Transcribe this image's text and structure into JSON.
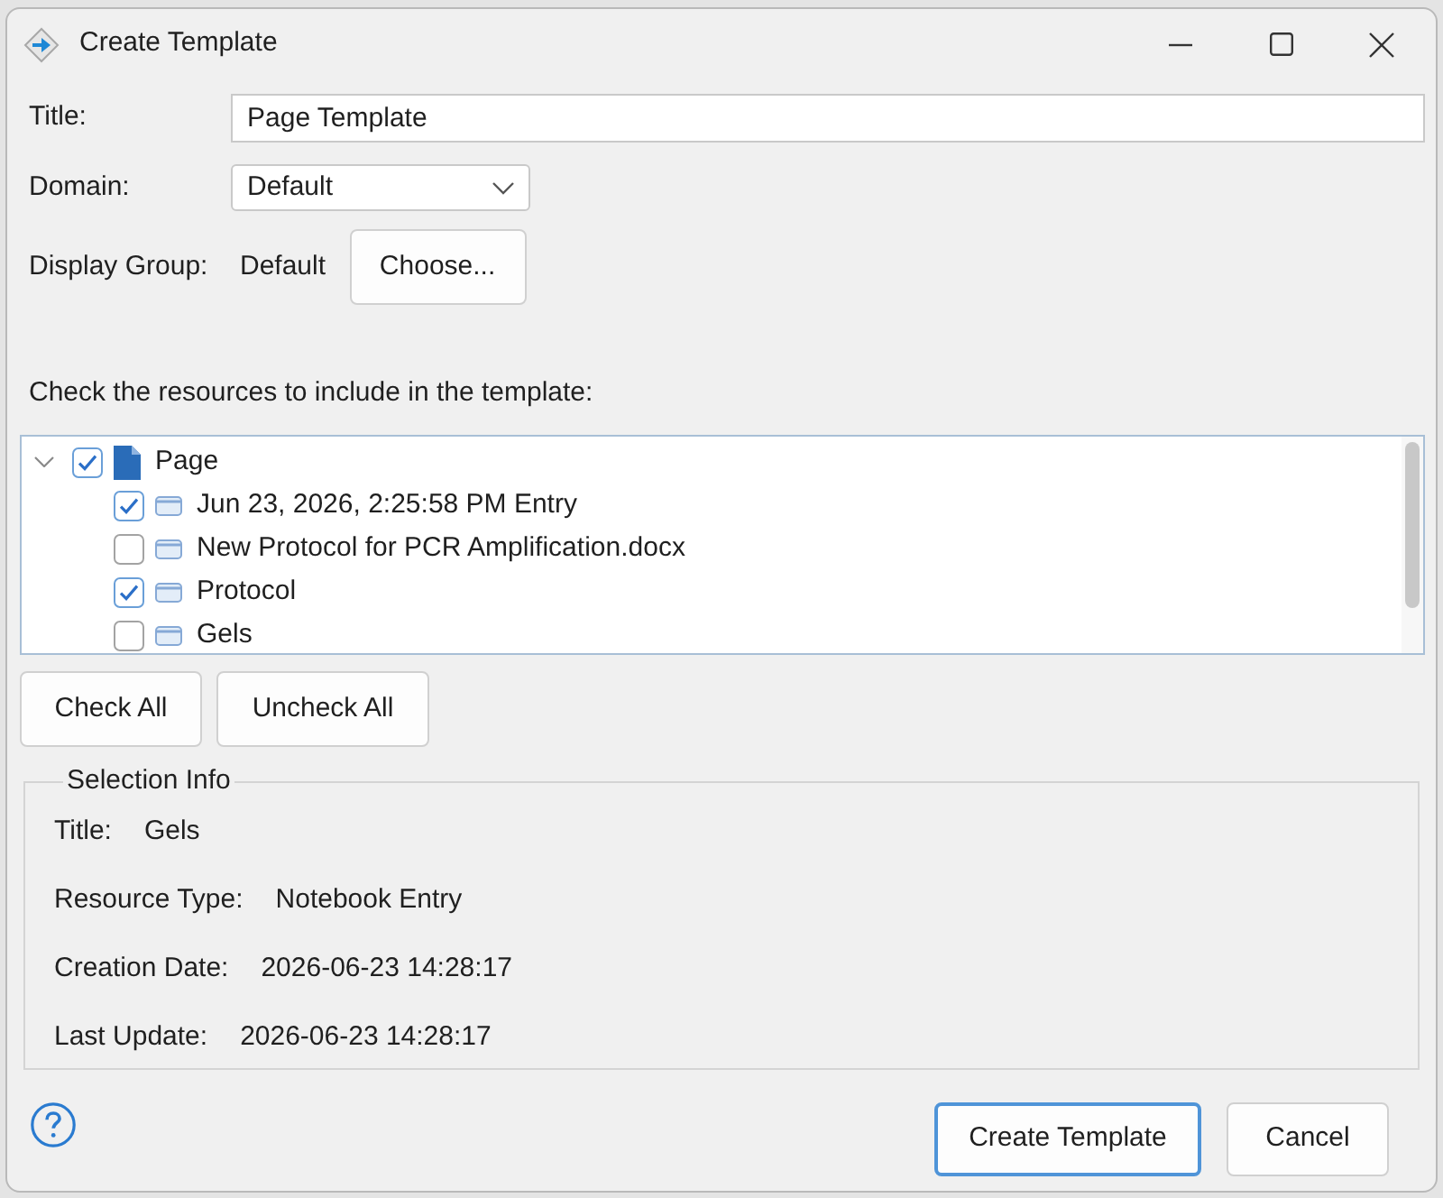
{
  "window": {
    "title": "Create Template"
  },
  "fields": [
    {
      "kind": "text",
      "label": "Title:",
      "value": "Page Template"
    },
    {
      "kind": "dropdown",
      "label": "Domain:",
      "value": "Default"
    },
    {
      "kind": "chooser",
      "label": "Display Group:",
      "value": "Default",
      "button": "Choose..."
    }
  ],
  "resources": {
    "prompt": "Check the resources to include in the template:",
    "tree": [
      {
        "kind": "page",
        "label": "Page",
        "checked": true,
        "expanded": true,
        "children": [
          {
            "kind": "entry",
            "label": "Jun 23, 2026, 2:25:58 PM Entry",
            "checked": true
          },
          {
            "kind": "entry",
            "label": "New Protocol for PCR Amplification.docx",
            "checked": false
          },
          {
            "kind": "entry",
            "label": "Protocol",
            "checked": true
          },
          {
            "kind": "entry",
            "label": "Gels",
            "checked": false
          }
        ]
      }
    ],
    "buttons": [
      "Check All",
      "Uncheck All"
    ]
  },
  "selection_info": {
    "title": "Selection Info",
    "rows": [
      {
        "label": "Title:",
        "value": "Gels"
      },
      {
        "label": "Resource Type:",
        "value": "Notebook Entry"
      },
      {
        "label": "Creation Date:",
        "value": "2026-06-23 14:28:17"
      },
      {
        "label": "Last Update:",
        "value": "2026-06-23 14:28:17"
      }
    ]
  },
  "footer": {
    "buttons": [
      {
        "label": "Create Template",
        "focused": true
      },
      {
        "label": "Cancel",
        "focused": false
      }
    ]
  }
}
